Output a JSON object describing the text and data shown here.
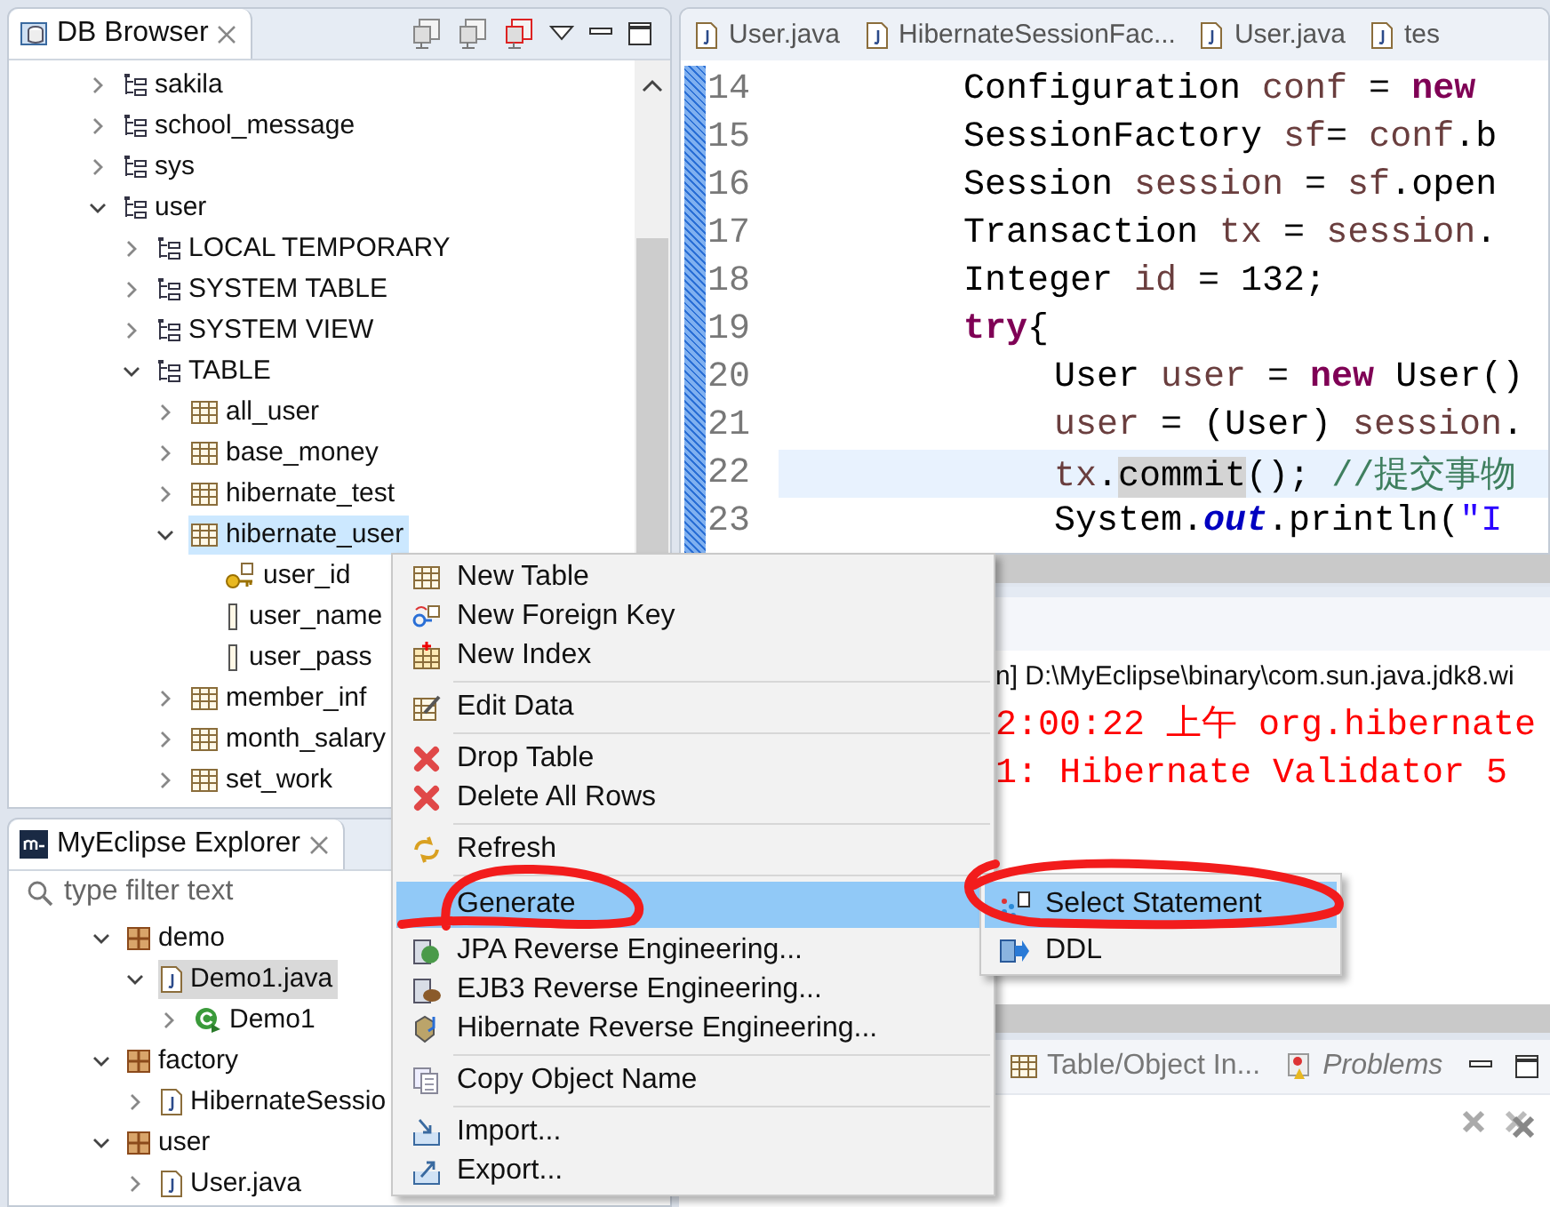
{
  "db_browser": {
    "title": "DB Browser",
    "tree": [
      {
        "label": "sakila",
        "kind": "schema",
        "expanded": false,
        "selected": false
      },
      {
        "label": "school_message",
        "kind": "schema",
        "expanded": false,
        "selected": false
      },
      {
        "label": "sys",
        "kind": "schema",
        "expanded": false,
        "selected": false
      },
      {
        "label": "user",
        "kind": "schema",
        "expanded": true,
        "selected": false,
        "children": [
          {
            "label": "LOCAL TEMPORARY",
            "kind": "schema",
            "expanded": false,
            "selected": false
          },
          {
            "label": "SYSTEM TABLE",
            "kind": "schema",
            "expanded": false,
            "selected": false
          },
          {
            "label": "SYSTEM VIEW",
            "kind": "schema",
            "expanded": false,
            "selected": false
          },
          {
            "label": "TABLE",
            "kind": "schema",
            "expanded": true,
            "selected": false,
            "children": [
              {
                "label": "all_user",
                "kind": "table",
                "expanded": false,
                "selected": false
              },
              {
                "label": "base_money",
                "kind": "table",
                "expanded": false,
                "selected": false
              },
              {
                "label": "hibernate_test",
                "kind": "table",
                "expanded": false,
                "selected": false
              },
              {
                "label": "hibernate_user",
                "kind": "table",
                "expanded": true,
                "selected": true,
                "children": [
                  {
                    "label": "user_id",
                    "kind": "key",
                    "selected": false
                  },
                  {
                    "label": "user_name",
                    "kind": "column",
                    "selected": false
                  },
                  {
                    "label": "user_pass",
                    "kind": "column",
                    "selected": false
                  }
                ]
              },
              {
                "label": "member_inf",
                "kind": "table",
                "expanded": false,
                "selected": false
              },
              {
                "label": "month_salary",
                "kind": "table",
                "expanded": false,
                "selected": false
              },
              {
                "label": "set_work",
                "kind": "table",
                "expanded": false,
                "selected": false
              }
            ]
          }
        ]
      }
    ]
  },
  "explorer": {
    "title": "MyEclipse Explorer",
    "filter": {
      "placeholder": "type filter text"
    },
    "tree": [
      {
        "label": "demo",
        "kind": "package",
        "expanded": true,
        "selected": false,
        "children": [
          {
            "label": "Demo1.java",
            "kind": "java-file",
            "expanded": true,
            "selected": true,
            "children": [
              {
                "label": "Demo1",
                "kind": "class",
                "expanded": false,
                "selected": false
              }
            ]
          }
        ]
      },
      {
        "label": "factory",
        "kind": "package",
        "expanded": true,
        "selected": false,
        "children": [
          {
            "label": "HibernateSessio",
            "kind": "java-file",
            "expanded": false,
            "selected": false
          }
        ]
      },
      {
        "label": "user",
        "kind": "package",
        "expanded": true,
        "selected": false,
        "children": [
          {
            "label": "User.java",
            "kind": "java-file",
            "expanded": false,
            "selected": false
          }
        ]
      }
    ]
  },
  "editor": {
    "tabs": [
      {
        "label": "User.java"
      },
      {
        "label": "HibernateSessionFac..."
      },
      {
        "label": "User.java"
      },
      {
        "label": "tes"
      }
    ],
    "lines": [
      {
        "number": "14",
        "current": false,
        "tokens": [
          {
            "kind": "plain",
            "text": "Configuration "
          },
          {
            "kind": "local",
            "text": "conf"
          },
          {
            "kind": "plain",
            "text": " = "
          },
          {
            "kind": "keyword",
            "text": "new"
          }
        ]
      },
      {
        "number": "15",
        "current": false,
        "tokens": [
          {
            "kind": "plain",
            "text": "SessionFactory "
          },
          {
            "kind": "local",
            "text": "sf"
          },
          {
            "kind": "plain",
            "text": "= "
          },
          {
            "kind": "local",
            "text": "conf"
          },
          {
            "kind": "plain",
            "text": ".b"
          }
        ]
      },
      {
        "number": "16",
        "current": false,
        "tokens": [
          {
            "kind": "plain",
            "text": "Session "
          },
          {
            "kind": "local",
            "text": "session"
          },
          {
            "kind": "plain",
            "text": " = "
          },
          {
            "kind": "local",
            "text": "sf"
          },
          {
            "kind": "plain",
            "text": ".open"
          }
        ]
      },
      {
        "number": "17",
        "current": false,
        "tokens": [
          {
            "kind": "plain",
            "text": "Transaction "
          },
          {
            "kind": "local",
            "text": "tx"
          },
          {
            "kind": "plain",
            "text": " = "
          },
          {
            "kind": "local",
            "text": "session"
          },
          {
            "kind": "plain",
            "text": "."
          }
        ]
      },
      {
        "number": "18",
        "current": false,
        "tokens": [
          {
            "kind": "plain",
            "text": "Integer "
          },
          {
            "kind": "local",
            "text": "id"
          },
          {
            "kind": "plain",
            "text": " = 132;"
          }
        ]
      },
      {
        "number": "19",
        "current": false,
        "tokens": [
          {
            "kind": "keyword",
            "text": "try"
          },
          {
            "kind": "plain",
            "text": "{"
          }
        ],
        "children": [
          {
            "number": "20",
            "current": false,
            "tokens": [
              {
                "kind": "plain",
                "text": "User "
              },
              {
                "kind": "local",
                "text": "user"
              },
              {
                "kind": "plain",
                "text": " = "
              },
              {
                "kind": "keyword",
                "text": "new"
              },
              {
                "kind": "plain",
                "text": " User()"
              }
            ]
          },
          {
            "number": "21",
            "current": false,
            "tokens": [
              {
                "kind": "local",
                "text": "user"
              },
              {
                "kind": "plain",
                "text": " = (User) "
              },
              {
                "kind": "local",
                "text": "session"
              },
              {
                "kind": "plain",
                "text": "."
              }
            ]
          },
          {
            "number": "22",
            "current": true,
            "tokens": [
              {
                "kind": "local",
                "text": "tx"
              },
              {
                "kind": "plain",
                "text": "."
              },
              {
                "kind": "occurrence",
                "text": "commit"
              },
              {
                "kind": "plain",
                "text": "(); "
              },
              {
                "kind": "comment",
                "text": "//提交事物"
              }
            ]
          },
          {
            "number": "23",
            "current": false,
            "tokens": [
              {
                "kind": "plain",
                "text": "System."
              },
              {
                "kind": "field",
                "text": "out"
              },
              {
                "kind": "plain",
                "text": ".println("
              },
              {
                "kind": "string",
                "text": "\"I"
              }
            ]
          }
        ]
      }
    ]
  },
  "console": {
    "header": "n] D:\\MyEclipse\\binary\\com.sun.java.jdk8.wi",
    "lines": [
      "2:00:22 上午 org.hibernate",
      "1: Hibernate Validator 5"
    ]
  },
  "bottom_panel": {
    "tabs": [
      {
        "label": "Table/Object In..."
      },
      {
        "label": "Problems"
      }
    ]
  },
  "context_menu": {
    "groups": [
      [
        {
          "label": "New Table",
          "selected": false
        },
        {
          "label": "New Foreign Key",
          "selected": false
        },
        {
          "label": "New Index",
          "selected": false
        }
      ],
      [
        {
          "label": "Edit Data",
          "selected": false
        }
      ],
      [
        {
          "label": "Drop Table",
          "selected": false
        },
        {
          "label": "Delete All Rows",
          "selected": false
        }
      ],
      [
        {
          "label": "Refresh",
          "selected": false
        }
      ],
      [
        {
          "label": "Generate",
          "selected": true
        },
        {
          "label": "JPA Reverse Engineering...",
          "selected": false
        },
        {
          "label": "EJB3 Reverse Engineering...",
          "selected": false
        },
        {
          "label": "Hibernate Reverse Engineering...",
          "selected": false
        }
      ],
      [
        {
          "label": "Copy Object Name",
          "selected": false
        }
      ],
      [
        {
          "label": "Import...",
          "selected": false
        },
        {
          "label": "Export...",
          "selected": false
        }
      ]
    ]
  },
  "submenu": {
    "items": [
      {
        "label": "Select Statement",
        "selected": true
      },
      {
        "label": "DDL",
        "selected": false
      }
    ]
  }
}
